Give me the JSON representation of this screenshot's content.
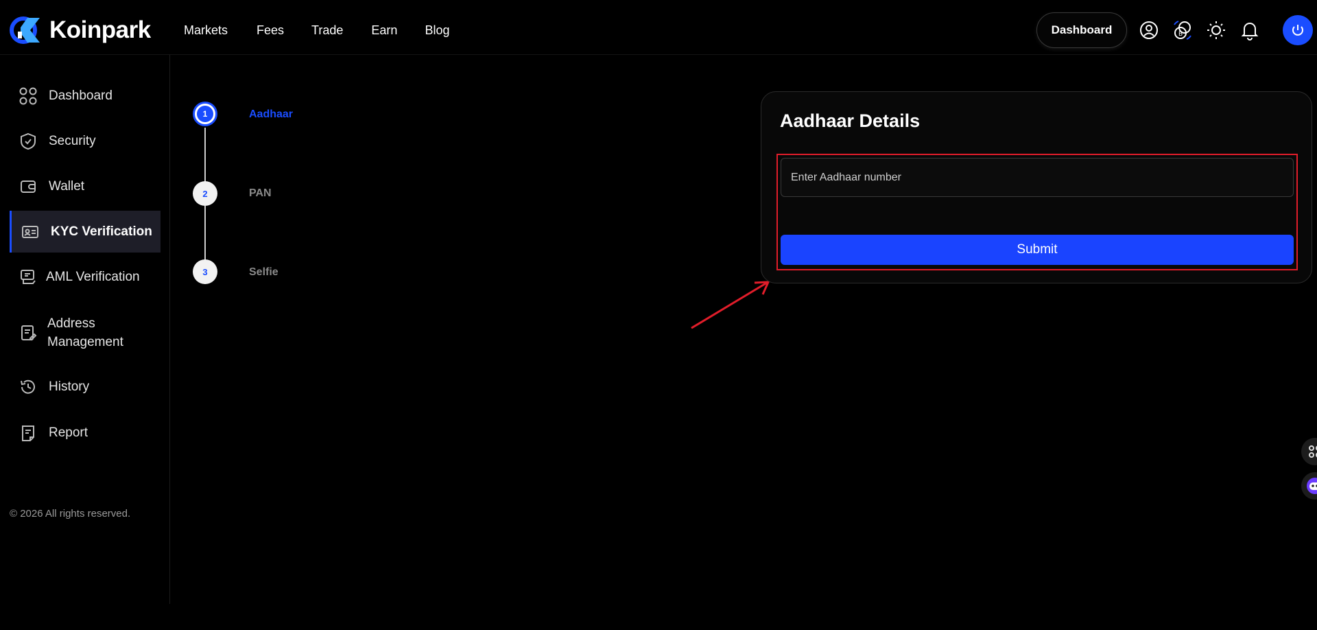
{
  "brand": {
    "name": "Koinpark",
    "accent": "#1a4dff"
  },
  "nav": {
    "items": [
      {
        "label": "Markets"
      },
      {
        "label": "Fees"
      },
      {
        "label": "Trade"
      },
      {
        "label": "Earn"
      },
      {
        "label": "Blog"
      }
    ]
  },
  "header": {
    "dashboard_label": "Dashboard",
    "icons": [
      "user-icon",
      "coins-icon",
      "sun-icon",
      "bell-icon",
      "power-icon"
    ]
  },
  "sidebar": {
    "items": [
      {
        "label": "Dashboard",
        "icon": "grid-icon"
      },
      {
        "label": "Security",
        "icon": "shield-icon"
      },
      {
        "label": "Wallet",
        "icon": "wallet-icon"
      },
      {
        "label": "KYC Verification",
        "icon": "id-card-icon",
        "active": true
      },
      {
        "label": "AML Verification",
        "icon": "aml-icon"
      },
      {
        "label": "Address Management",
        "icon": "document-edit-icon"
      },
      {
        "label": "History",
        "icon": "history-icon"
      },
      {
        "label": "Report",
        "icon": "report-icon"
      }
    ],
    "copyright": "© 2026 All rights reserved."
  },
  "stepper": {
    "steps": [
      {
        "number": "1",
        "label": "Aadhaar",
        "active": true
      },
      {
        "number": "2",
        "label": "PAN"
      },
      {
        "number": "3",
        "label": "Selfie"
      }
    ]
  },
  "form": {
    "title": "Aadhaar Details",
    "input_placeholder": "Enter Aadhaar number",
    "input_value": "",
    "submit_label": "Submit"
  }
}
